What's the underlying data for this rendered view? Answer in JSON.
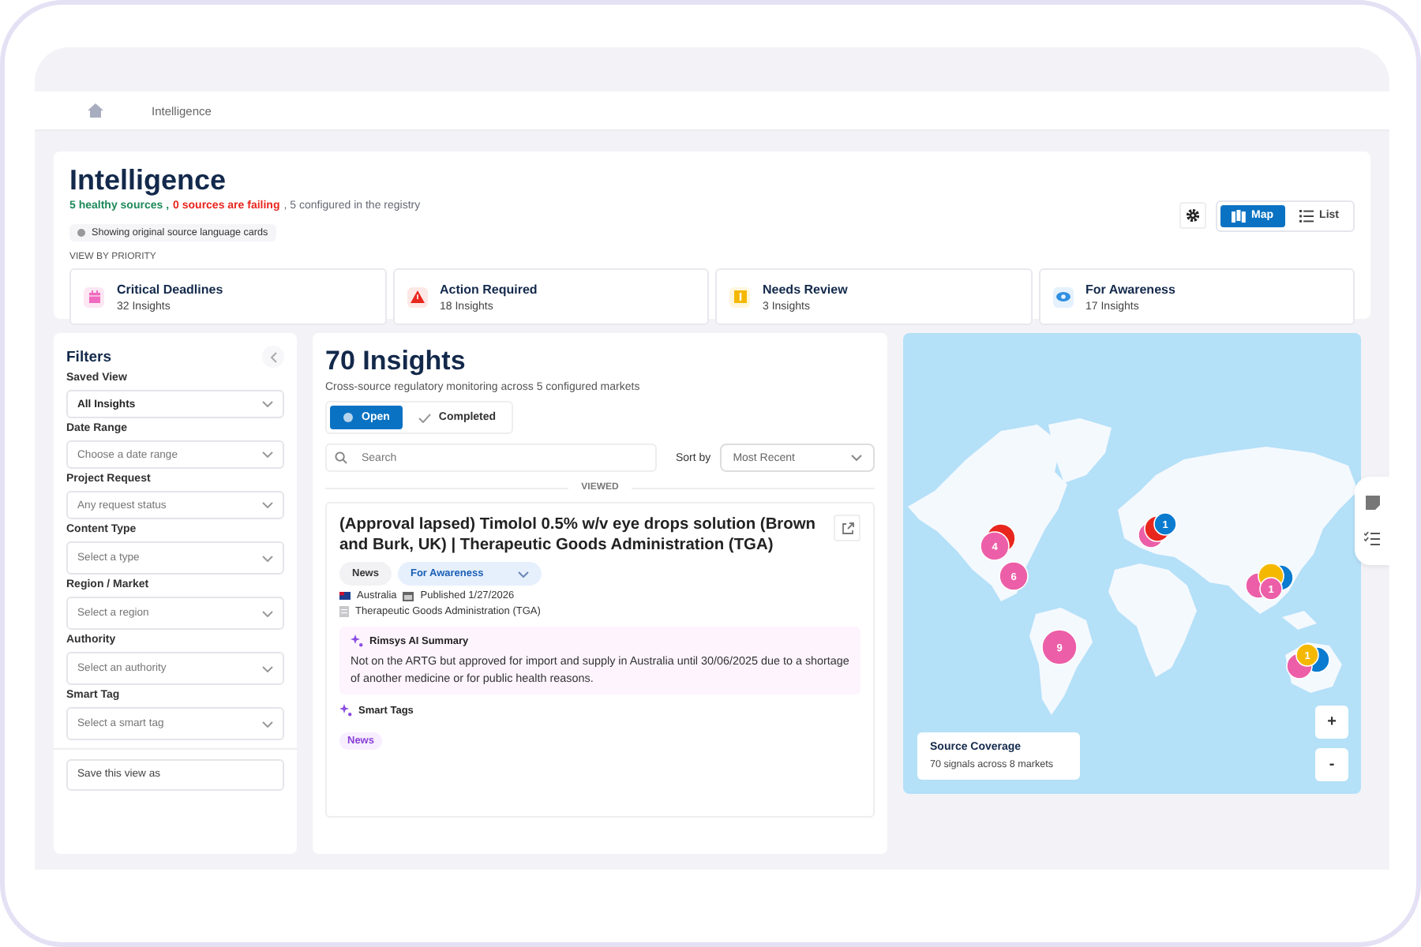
{
  "breadcrumb": {
    "current": "Intelligence"
  },
  "header": {
    "title": "Intelligence",
    "status": [
      {
        "kind": "healthy",
        "text": "5 healthy sources ,"
      },
      {
        "kind": "failing",
        "text": "0 sources are failing"
      },
      {
        "kind": "plain",
        "text": ", 5 configured in the registry"
      }
    ],
    "language_note": "Showing original source language cards",
    "view_toggle": [
      {
        "kind": "map",
        "label": "Map",
        "selected": true
      },
      {
        "kind": "list",
        "label": "List",
        "selected": false
      }
    ],
    "priority_heading": "VIEW BY PRIORITY",
    "priority_cards": [
      {
        "kind": "deadline",
        "title": "Critical Deadlines",
        "count": "32 Insights"
      },
      {
        "kind": "action",
        "title": "Action Required",
        "count": "18 Insights"
      },
      {
        "kind": "review",
        "title": "Needs Review",
        "count": "3 Insights"
      },
      {
        "kind": "awareness",
        "title": "For Awareness",
        "count": "17 Insights"
      }
    ]
  },
  "filters": {
    "title": "Filters",
    "fields": [
      {
        "label": "Saved View",
        "value": "All Insights"
      },
      {
        "label": "Date Range",
        "placeholder": "Choose a date range"
      },
      {
        "label": "Project Request",
        "placeholder": "Any request status"
      },
      {
        "label": "Content Type",
        "placeholder": "Select a type"
      },
      {
        "label": "Region / Market",
        "placeholder": "Select a region"
      },
      {
        "label": "Authority",
        "placeholder": "Select an authority"
      },
      {
        "label": "Smart Tag",
        "placeholder": "Select a smart tag"
      }
    ],
    "save_view": {
      "placeholder": "Save this view as"
    }
  },
  "insights": {
    "title": "70 Insights",
    "subtitle": "Cross-source regulatory monitoring across 5 configured markets",
    "status_tabs": [
      {
        "label": "Open",
        "selected": true
      },
      {
        "label": "Completed",
        "selected": false
      }
    ],
    "search": {
      "placeholder": "Search"
    },
    "sort": {
      "label": "Sort by",
      "value": "Most Recent"
    },
    "section": "VIEWED",
    "card": {
      "title": "(Approval lapsed) Timolol 0.5% w/v eye drops solution (Brown and Burk, UK) | Therapeutic Goods Administration (TGA)",
      "content_type": "News",
      "priority": "For Awareness",
      "country": "Australia",
      "published": "Published 1/27/2026",
      "authority": "Therapeutic Goods Administration (TGA)",
      "summary": {
        "title": "Rimsys AI Summary",
        "text": "Not on the ARTG but approved for import and supply in Australia until 30/06/2025 due to a shortage of another medicine or for public health reasons."
      },
      "smart_tags": {
        "title": "Smart Tags",
        "tags": [
          "News"
        ]
      }
    }
  },
  "map": {
    "clusters": [
      {
        "label": "4",
        "markers": [
          {
            "color": "#e8261e"
          },
          {
            "color": "#ec5fa8"
          }
        ]
      },
      {
        "label": "6",
        "markers": [
          {
            "color": "#ec5fa8"
          }
        ]
      },
      {
        "label": "9",
        "markers": [
          {
            "color": "#ec5fa8"
          }
        ]
      },
      {
        "label": "1",
        "markers": [
          {
            "color": "#ec5fa8"
          },
          {
            "color": "#e8261e"
          },
          {
            "color": "#0a7bcf"
          }
        ]
      },
      {
        "label": "1",
        "markers": [
          {
            "color": "#0a7bcf"
          },
          {
            "color": "#ec5fa8"
          },
          {
            "color": "#f5b800"
          },
          {
            "color": "#ec5fa8"
          }
        ]
      },
      {
        "label": "1",
        "markers": [
          {
            "color": "#0a7bcf"
          },
          {
            "color": "#ec5fa8"
          },
          {
            "color": "#f5b800"
          }
        ]
      }
    ],
    "coverage": {
      "title": "Source Coverage",
      "text": "70 signals across 8 markets"
    },
    "zoom": [
      "+",
      "-"
    ]
  }
}
